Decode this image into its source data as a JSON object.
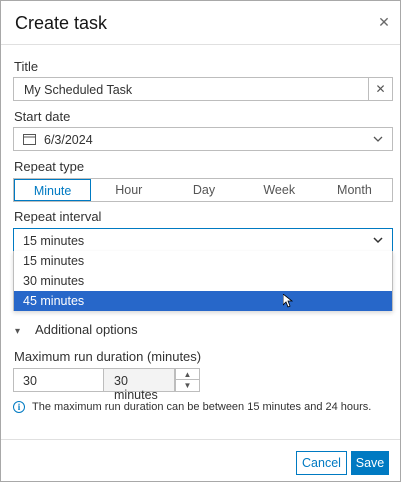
{
  "dialog": {
    "title": "Create task",
    "close_icon": "close-icon"
  },
  "title_field": {
    "label": "Title",
    "value": "My Scheduled Task",
    "clear_icon": "x-icon"
  },
  "start_date": {
    "label": "Start date",
    "value": "6/3/2024",
    "icon": "calendar-icon"
  },
  "repeat_type": {
    "label": "Repeat type",
    "options": [
      "Minute",
      "Hour",
      "Day",
      "Week",
      "Month"
    ],
    "selected": "Minute"
  },
  "repeat_interval": {
    "label": "Repeat interval",
    "value": "15 minutes",
    "options": [
      "15 minutes",
      "30 minutes",
      "45 minutes"
    ],
    "highlighted": "45 minutes"
  },
  "additional_options": {
    "label": "Additional options",
    "expanded": false
  },
  "max_duration": {
    "label": "Maximum run duration (minutes)",
    "value": "30",
    "suffix": "30 minutes"
  },
  "info": {
    "text": "The maximum run duration can be between 15 minutes and 24 hours."
  },
  "footer": {
    "cancel_label": "Cancel",
    "save_label": "Save"
  },
  "colors": {
    "accent": "#007ac2",
    "highlight": "#2767c9"
  }
}
